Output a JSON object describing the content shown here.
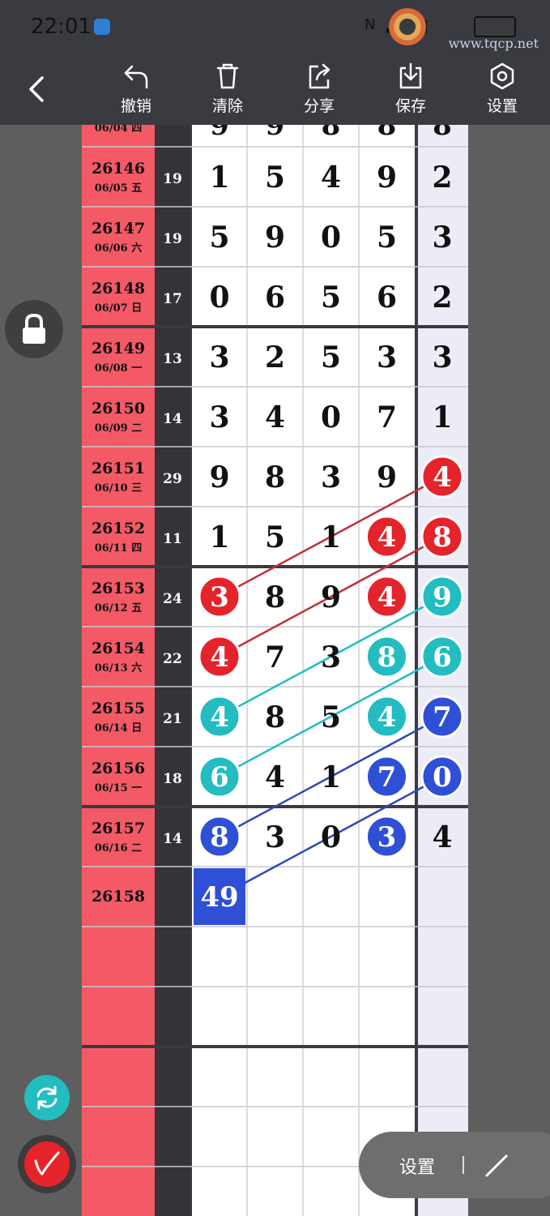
{
  "status": {
    "time": "22:01",
    "watermark": "www.tqcp.net"
  },
  "toolbar": {
    "items": [
      {
        "label": "撤销",
        "icon": "undo-icon"
      },
      {
        "label": "清除",
        "icon": "trash-icon"
      },
      {
        "label": "分享",
        "icon": "share-icon"
      },
      {
        "label": "保存",
        "icon": "download-icon"
      },
      {
        "label": "设置",
        "icon": "settings-hexagon-icon"
      }
    ]
  },
  "partial_row": {
    "date": "06/04 四"
  },
  "rows": [
    {
      "id": "26146",
      "date": "06/05 五",
      "sum": "19",
      "digits": [
        "1",
        "5",
        "4",
        "9"
      ],
      "last": "2"
    },
    {
      "id": "26147",
      "date": "06/06 六",
      "sum": "19",
      "digits": [
        "5",
        "9",
        "0",
        "5"
      ],
      "last": "3"
    },
    {
      "id": "26148",
      "date": "06/07 日",
      "sum": "17",
      "digits": [
        "0",
        "6",
        "5",
        "6"
      ],
      "last": "2"
    },
    {
      "id": "26149",
      "date": "06/08 一",
      "sum": "13",
      "digits": [
        "3",
        "2",
        "5",
        "3"
      ],
      "last": "3"
    },
    {
      "id": "26150",
      "date": "06/09 二",
      "sum": "14",
      "digits": [
        "3",
        "4",
        "0",
        "7"
      ],
      "last": "1"
    },
    {
      "id": "26151",
      "date": "06/10 三",
      "sum": "29",
      "digits": [
        "9",
        "8",
        "3",
        "9"
      ],
      "last": "4"
    },
    {
      "id": "26152",
      "date": "06/11 四",
      "sum": "11",
      "digits": [
        "1",
        "5",
        "1",
        "4"
      ],
      "last": "8"
    },
    {
      "id": "26153",
      "date": "06/12 五",
      "sum": "24",
      "digits": [
        "3",
        "8",
        "9",
        "4"
      ],
      "last": "9"
    },
    {
      "id": "26154",
      "date": "06/13 六",
      "sum": "22",
      "digits": [
        "4",
        "7",
        "3",
        "8"
      ],
      "last": "6"
    },
    {
      "id": "26155",
      "date": "06/14 日",
      "sum": "21",
      "digits": [
        "4",
        "8",
        "5",
        "4"
      ],
      "last": "7"
    },
    {
      "id": "26156",
      "date": "06/15 一",
      "sum": "18",
      "digits": [
        "6",
        "4",
        "1",
        "7"
      ],
      "last": "0"
    },
    {
      "id": "26157",
      "date": "06/16 二",
      "sum": "14",
      "digits": [
        "8",
        "3",
        "0",
        "3"
      ],
      "last": "4"
    },
    {
      "id": "26158",
      "date": "",
      "sum": "",
      "digits": [
        "49",
        "",
        "",
        ""
      ],
      "last": ""
    },
    {
      "id": "",
      "date": "",
      "sum": "",
      "digits": [
        "",
        "",
        "",
        ""
      ],
      "last": ""
    },
    {
      "id": "",
      "date": "",
      "sum": "",
      "digits": [
        "",
        "",
        "",
        ""
      ],
      "last": ""
    },
    {
      "id": "",
      "date": "",
      "sum": "",
      "digits": [
        "",
        "",
        "",
        ""
      ],
      "last": ""
    },
    {
      "id": "",
      "date": "",
      "sum": "",
      "digits": [
        "",
        "",
        "",
        ""
      ],
      "last": ""
    },
    {
      "id": "",
      "date": "",
      "sum": "",
      "digits": [
        "",
        "",
        "",
        ""
      ],
      "last": ""
    }
  ],
  "markers": [
    {
      "row": 5,
      "col": 4,
      "color": "#e5232b"
    },
    {
      "row": 6,
      "col": 3,
      "color": "#e5232b"
    },
    {
      "row": 6,
      "col": 4,
      "color": "#e5232b"
    },
    {
      "row": 7,
      "col": 0,
      "color": "#e5232b"
    },
    {
      "row": 7,
      "col": 3,
      "color": "#e5232b"
    },
    {
      "row": 7,
      "col": 4,
      "color": "#23bcc0"
    },
    {
      "row": 8,
      "col": 0,
      "color": "#e5232b"
    },
    {
      "row": 8,
      "col": 3,
      "color": "#23bcc0"
    },
    {
      "row": 8,
      "col": 4,
      "color": "#23bcc0"
    },
    {
      "row": 9,
      "col": 0,
      "color": "#23bcc0"
    },
    {
      "row": 9,
      "col": 3,
      "color": "#23bcc0"
    },
    {
      "row": 9,
      "col": 4,
      "color": "#2f4fd6"
    },
    {
      "row": 10,
      "col": 0,
      "color": "#23bcc0"
    },
    {
      "row": 10,
      "col": 3,
      "color": "#2f4fd6"
    },
    {
      "row": 10,
      "col": 4,
      "color": "#2f4fd6"
    },
    {
      "row": 11,
      "col": 0,
      "color": "#2f4fd6"
    },
    {
      "row": 11,
      "col": 3,
      "color": "#2f4fd6"
    }
  ],
  "highlight_box": {
    "row": 12,
    "col": 0,
    "color": "#2f4fd6"
  },
  "lines": [
    {
      "from": [
        5,
        4
      ],
      "to": [
        7,
        0
      ],
      "color": "#c0303a"
    },
    {
      "from": [
        6,
        4
      ],
      "to": [
        8,
        0
      ],
      "color": "#c0303a"
    },
    {
      "from": [
        7,
        4
      ],
      "to": [
        9,
        0
      ],
      "color": "#23bcc0"
    },
    {
      "from": [
        8,
        4
      ],
      "to": [
        10,
        0
      ],
      "color": "#23bcc0"
    },
    {
      "from": [
        9,
        4
      ],
      "to": [
        11,
        0
      ],
      "color": "#3048b8"
    },
    {
      "from": [
        10,
        4
      ],
      "to": [
        12,
        0
      ],
      "color": "#3048b8"
    }
  ],
  "floating": {
    "settings_label": "设置"
  },
  "colors": {
    "date_column": "#f35a66",
    "last_column": "#ececf6",
    "dark_band": "#333338"
  }
}
